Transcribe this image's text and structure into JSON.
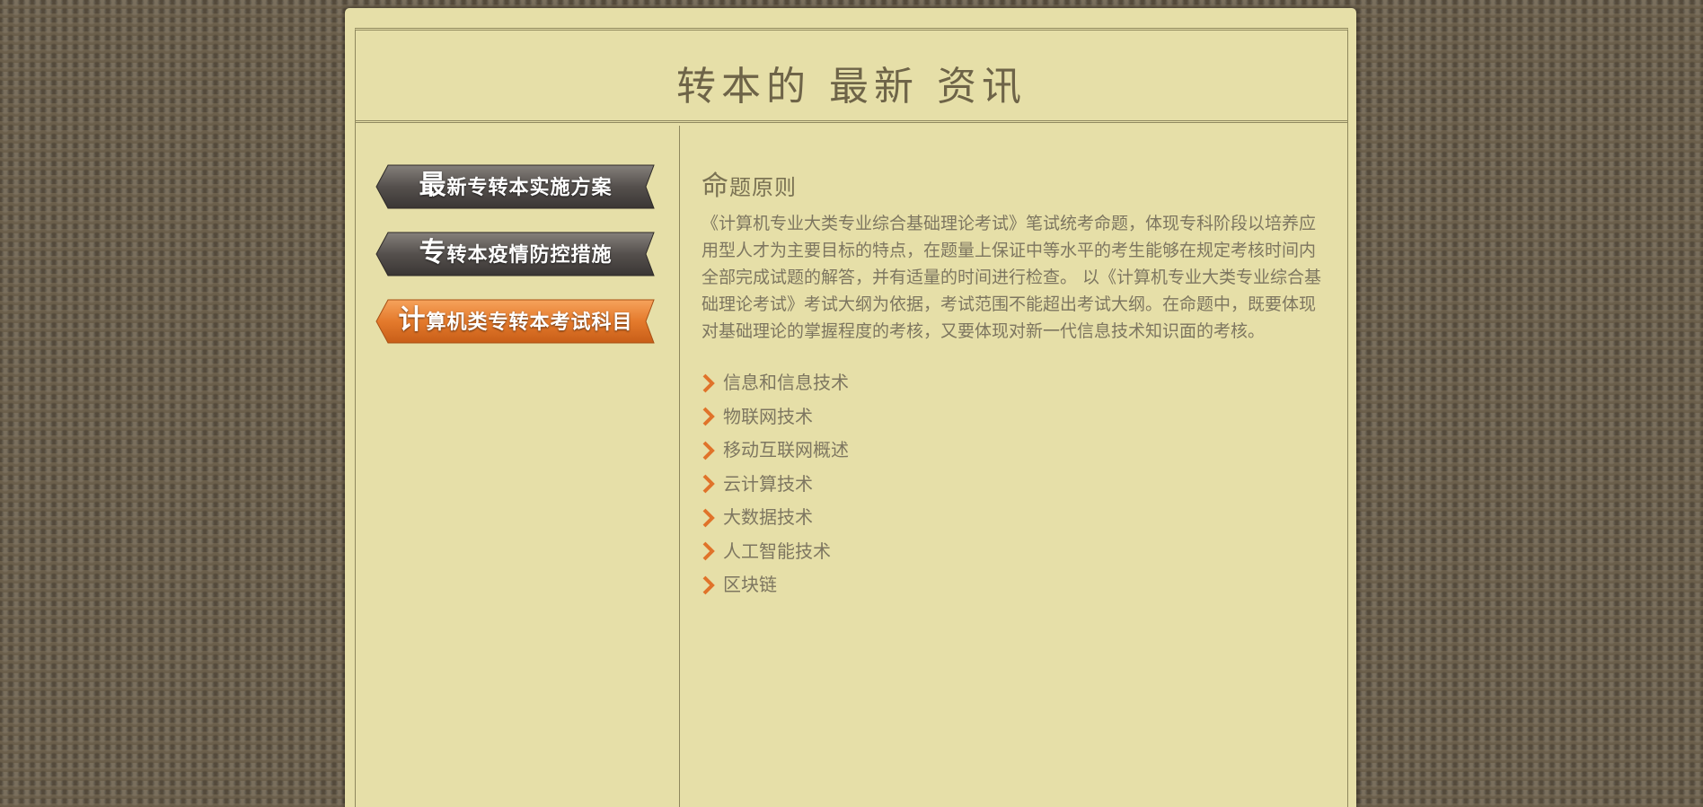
{
  "header": {
    "title": "转本的 最新 资讯"
  },
  "nav": {
    "items": [
      {
        "first": "最",
        "rest": "新专转本实施方案",
        "state": "normal"
      },
      {
        "first": "专",
        "rest": "转本疫情防控措施",
        "state": "normal"
      },
      {
        "first": "计",
        "rest": "算机类专转本考试科目",
        "state": "active"
      }
    ]
  },
  "article": {
    "heading_first": "命",
    "heading_rest": "题原则",
    "paragraph": "《计算机专业大类专业综合基础理论考试》笔试统考命题，体现专科阶段以培养应用型人才为主要目标的特点，在题量上保证中等水平的考生能够在规定考核时间内全部完成试题的解答，并有适量的时间进行检查。 以《计算机专业大类专业综合基础理论考试》考试大纲为依据，考试范围不能超出考试大纲。在命题中，既要体现对基础理论的掌握程度的考核，又要体现对新一代信息技术知识面的考核。",
    "topics": [
      "信息和信息技术",
      "物联网技术",
      "移动互联网概述",
      "云计算技术",
      "大数据技术",
      "人工智能技术",
      "区块链"
    ]
  },
  "colors": {
    "panel_bg": "#e6dfa8",
    "page_bg": "#6b5f4b",
    "nav_dark": "#4a4644",
    "nav_active": "#e0732a",
    "bullet_chevron": "#e0732a",
    "text": "#7d7660"
  }
}
